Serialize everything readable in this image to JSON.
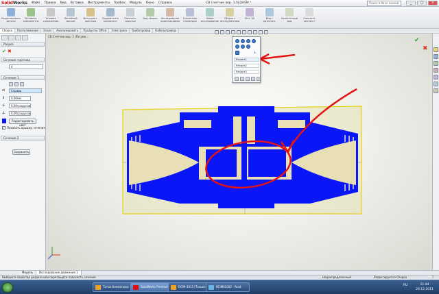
{
  "titlebar": {
    "logo_main": "Solid",
    "logo_tail": "Works",
    "menu": [
      "Файл",
      "Правка",
      "Вид",
      "Вставка",
      "Инструменты",
      "Toolbox",
      "Модуль",
      "Окно",
      "Справка"
    ],
    "document_title": "CB Счетчик вер. 1.SLDASM *",
    "search_placeholder": "Поиск в базе знаний",
    "min": "_",
    "max": "□",
    "close": "×"
  },
  "ribbon": {
    "buttons": [
      "Редактировать деталь",
      "Вставить компоненты",
      "Условия сопряжения",
      "Линейный массив",
      "Интеллект. крепежи",
      "Переместить компонент",
      "Показать скрытые",
      "Вид сборки",
      "Исследование проектирования",
      "Ссылочная геометрия",
      "Новое исследование",
      "Сборка с инструментами",
      "Мгн. 3D",
      "Вид с разнесен.",
      "Разнесенный вид",
      "Показать контекст"
    ]
  },
  "ribbon_tabs": [
    "Сборка",
    "Расположение",
    "Эскиз",
    "Анализировать",
    "Продукты Office",
    "Электрика",
    "Трубопровод",
    "Кабельпровод"
  ],
  "leftpanel": {
    "title": "Разрез",
    "section_method": "Сечение чертежа",
    "method_value": "4",
    "section1_head": "Сечение 1",
    "plane_value": "Справа",
    "offset_value": "0,00мм",
    "angle1_value": "0,00градусов",
    "angle2_value": "0,00градусов",
    "edit_color_label": "Редактировать цвет",
    "show_cap_label": "Показать крышку сечения",
    "section2_head": "Сечение 2",
    "save_label": "Сохранить"
  },
  "tree": {
    "root": "CB Счетчик вер. 1 (По умо..."
  },
  "popup": {
    "items": [
      "Разрез1",
      "Разрез2",
      "Разрез3"
    ]
  },
  "bottom_tabs": [
    "Модель",
    "Исследование движения 1"
  ],
  "status": {
    "left": "Выберите свойства разреза или перетащите плоскость сечения",
    "mid": "Недоопределенный",
    "right": "Редактируется Сборка",
    "help": "?"
  },
  "taskbar": {
    "items": [
      "Тотал Коммандер",
      "SolidWorks Premium 2...",
      "DCIM-2011 [Только...",
      "BCIM01002 - Paint"
    ],
    "lang": "RU",
    "time": "11:44",
    "date": "26.12.2011"
  },
  "colors": {
    "section_fill": "#0a16f5",
    "part_body": "#e8e0b4",
    "annotation_red": "#e31414",
    "plane_edge": "#e6d21e"
  }
}
